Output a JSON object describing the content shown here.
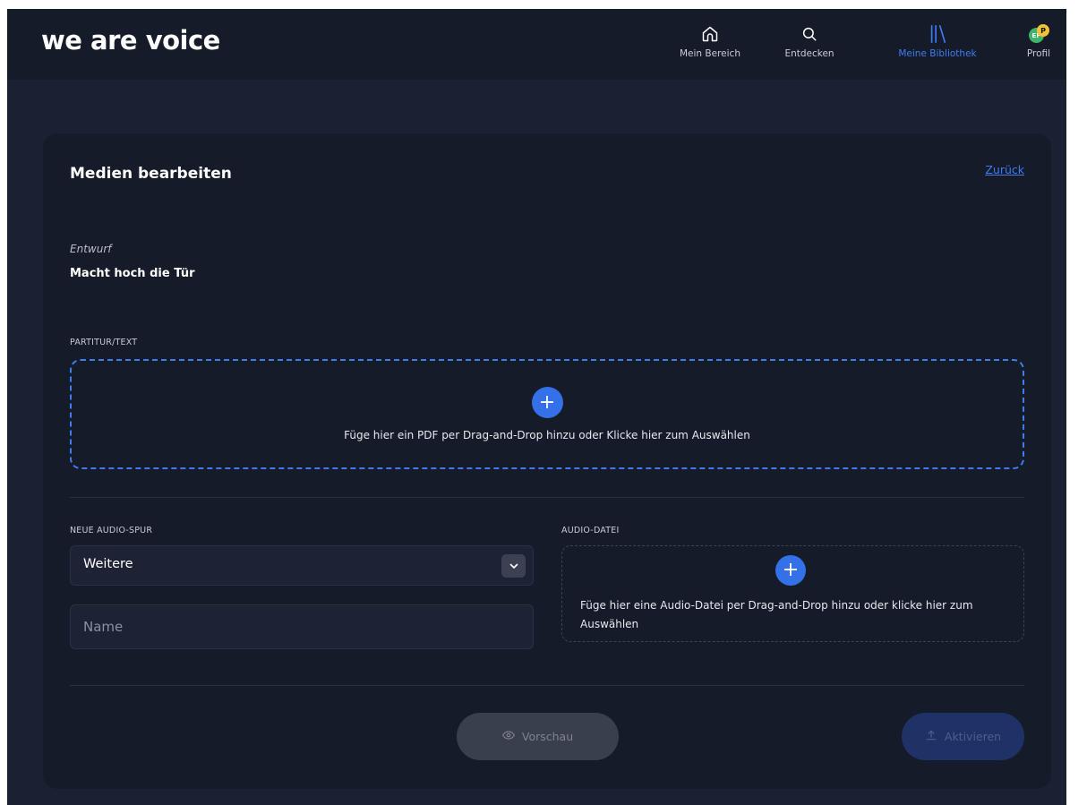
{
  "brand": {
    "logo": "we are voice"
  },
  "nav": {
    "items": [
      {
        "label": "Mein Bereich",
        "icon": "home-icon"
      },
      {
        "label": "Entdecken",
        "icon": "search-icon"
      },
      {
        "label": "Meine Bibliothek",
        "icon": "library-icon",
        "active": true
      },
      {
        "label": "Profil",
        "icon": "avatar"
      }
    ],
    "avatar": {
      "primary_initials": "EP",
      "badge": "P"
    }
  },
  "page": {
    "title": "Medien bearbeiten",
    "back_link": "Zurück",
    "status": "Entwurf",
    "song_title": "Macht hoch die Tür"
  },
  "score": {
    "label": "PARTITUR/TEXT",
    "drop_text": "Füge hier ein PDF per Drag-and-Drop hinzu oder Klicke hier zum Auswählen"
  },
  "audio_track": {
    "label": "NEUE AUDIO-SPUR",
    "selected": "Weitere",
    "name_placeholder": "Name"
  },
  "audio_file": {
    "label": "AUDIO-DATEI",
    "drop_text": "Füge hier eine Audio-Datei per Drag-and-Drop hinzu oder klicke hier zum Auswählen"
  },
  "actions": {
    "preview": "Vorschau",
    "activate": "Aktivieren"
  },
  "colors": {
    "accent": "#3f7cf2",
    "background": "#1b2133",
    "card": "#151b29"
  }
}
